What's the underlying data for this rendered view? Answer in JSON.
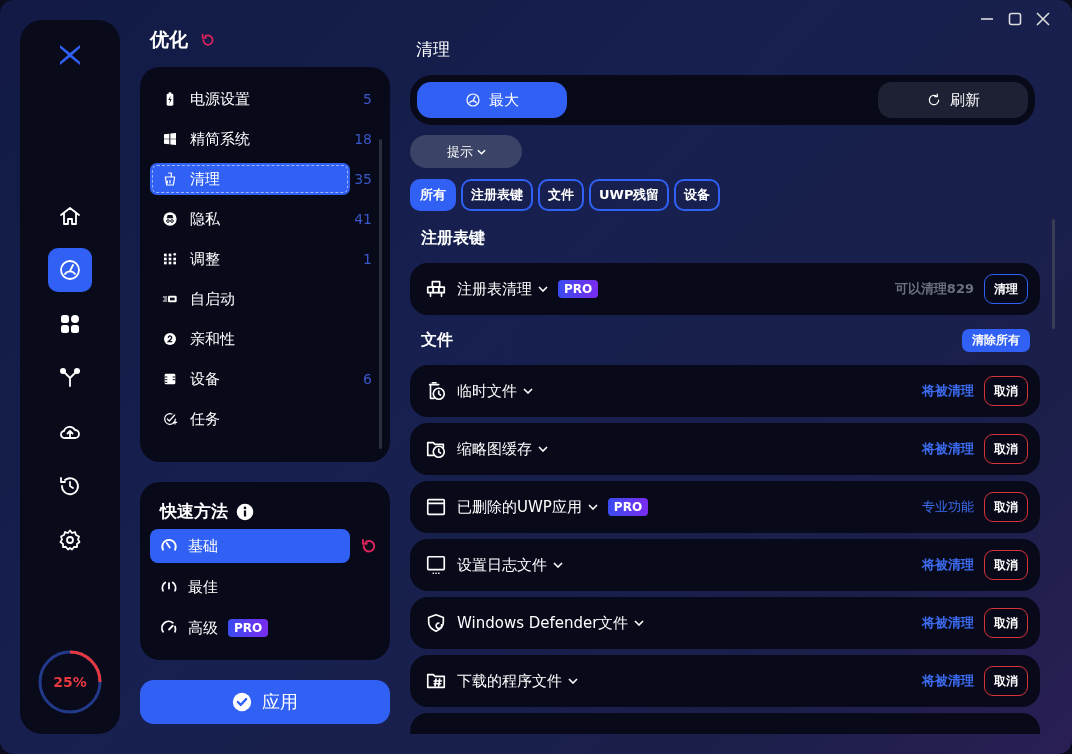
{
  "rail": {
    "items": [
      {
        "selected": false
      },
      {
        "selected": true
      },
      {
        "selected": false
      },
      {
        "selected": false
      },
      {
        "selected": false
      },
      {
        "selected": false
      },
      {
        "selected": false
      }
    ],
    "progress": {
      "level": 0.25,
      "label": "25%"
    }
  },
  "optimize": {
    "title": "优化",
    "items": [
      {
        "label": "电源设置",
        "count": "5",
        "selected": false
      },
      {
        "label": "精简系统",
        "count": "18",
        "selected": false
      },
      {
        "label": "清理",
        "count": "35",
        "selected": true
      },
      {
        "label": "隐私",
        "count": "41",
        "selected": false
      },
      {
        "label": "调整",
        "count": "1",
        "selected": false
      },
      {
        "label": "自启动",
        "selected": false
      },
      {
        "label": "亲和性",
        "selected": false
      },
      {
        "label": "设备",
        "count": "6",
        "selected": false
      },
      {
        "label": "任务",
        "selected": false
      }
    ]
  },
  "quick": {
    "title": "快速方法",
    "items": [
      {
        "label": "基础",
        "selected": true
      },
      {
        "label": "最佳",
        "selected": false
      },
      {
        "label": "高级",
        "pro": "PRO",
        "selected": false
      }
    ]
  },
  "apply_button": "应用",
  "main": {
    "title": "清理",
    "modes": [
      {
        "label": "最大",
        "selected": true
      },
      {
        "label": "刷新",
        "selected": false
      }
    ],
    "hint": "提示",
    "filters": [
      {
        "label": "所有",
        "selected": true
      },
      {
        "label": "注册表键",
        "selected": false
      },
      {
        "label": "文件",
        "selected": false
      },
      {
        "label": "UWP残留",
        "selected": false
      },
      {
        "label": "设备",
        "selected": false
      }
    ],
    "sections": [
      {
        "title": "注册表键",
        "rows": [
          {
            "label": "注册表清理",
            "pro": "PRO",
            "status": {
              "text": "可以清理829",
              "kind": "info"
            },
            "button": {
              "label": "清理",
              "kind": "clean"
            }
          }
        ]
      },
      {
        "title": "文件",
        "action": "清除所有",
        "rows": [
          {
            "label": "临时文件",
            "status": {
              "text": "将被清理",
              "kind": "pending"
            },
            "button": {
              "label": "取消",
              "kind": "cancel"
            }
          },
          {
            "label": "缩略图缓存",
            "status": {
              "text": "将被清理",
              "kind": "pending"
            },
            "button": {
              "label": "取消",
              "kind": "cancel"
            }
          },
          {
            "label": "已删除的UWP应用",
            "pro": "PRO",
            "status": {
              "text": "专业功能",
              "kind": "pro"
            },
            "button": {
              "label": "取消",
              "kind": "cancel"
            }
          },
          {
            "label": "设置日志文件",
            "status": {
              "text": "将被清理",
              "kind": "pending"
            },
            "button": {
              "label": "取消",
              "kind": "cancel"
            }
          },
          {
            "label": "Windows Defender文件",
            "status": {
              "text": "将被清理",
              "kind": "pending"
            },
            "button": {
              "label": "取消",
              "kind": "cancel"
            }
          },
          {
            "label": "下载的程序文件",
            "status": {
              "text": "将被清理",
              "kind": "pending"
            },
            "button": {
              "label": "取消",
              "kind": "cancel"
            }
          }
        ]
      }
    ]
  }
}
